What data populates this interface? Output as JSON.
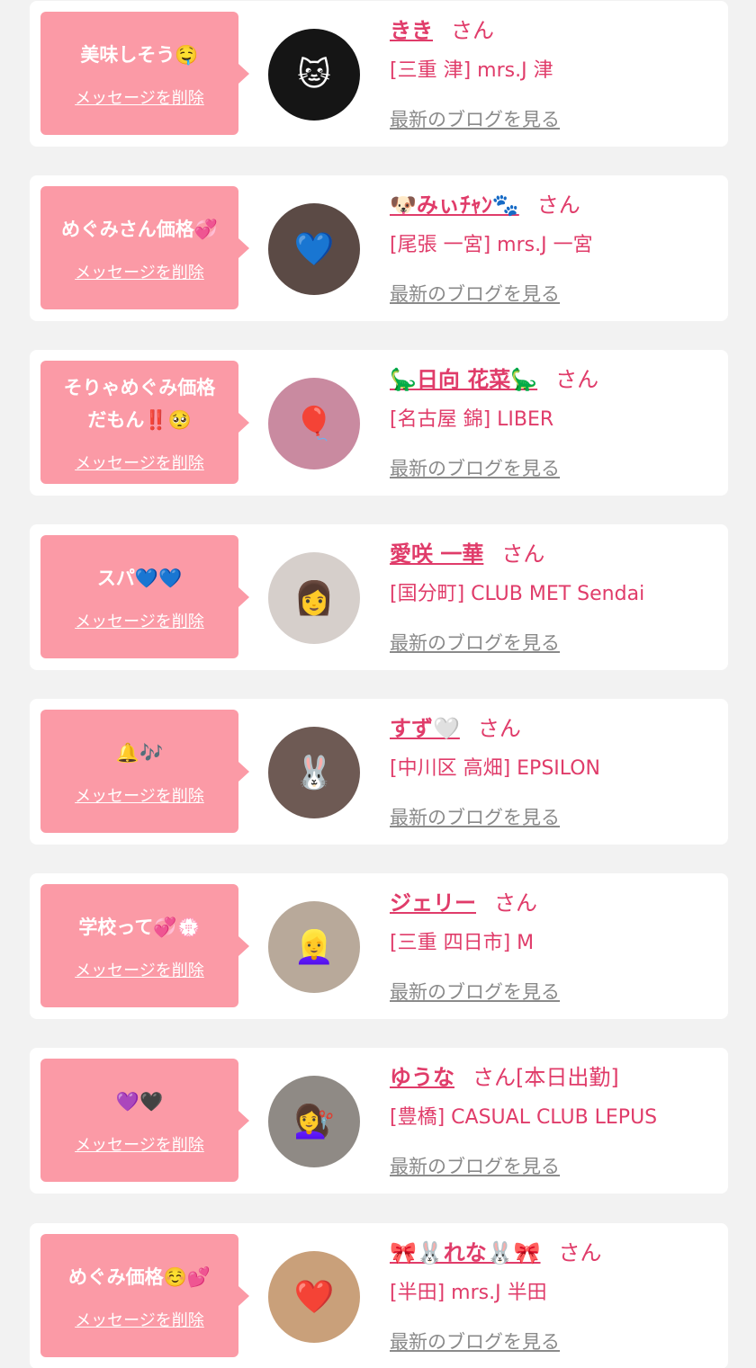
{
  "delete_label": "メッセージを削除",
  "blog_label": "最新のブログを見る",
  "honorific": "さん",
  "colors": {
    "bubble": "#fb9aa6",
    "accent": "#e03c6a",
    "muted": "#8a8a8a",
    "page_bg": "#f2f2f2"
  },
  "messages": [
    {
      "message": "美味しそう🤤",
      "name": "きき",
      "suffix": "さん",
      "shop": "[三重 津] mrs.J 津",
      "avatar_icon": "black-cat-avatar",
      "avatar_bg": "#151515",
      "avatar_glyph": "🐱"
    },
    {
      "message": "めぐみさん価格💞",
      "name": "🐶みぃﾁｬﾝ🐾",
      "suffix": "さん",
      "shop": "[尾張 一宮] mrs.J 一宮",
      "avatar_icon": "woman-heart-sticker-avatar",
      "avatar_bg": "#5b4a45",
      "avatar_glyph": "💙"
    },
    {
      "message": "そりゃめぐみ価格\nだもん‼️🥺",
      "name": "🦕日向 花菜🦕",
      "suffix": "さん",
      "shop": "[名古屋 錦] LIBER",
      "avatar_icon": "ball-pit-avatar",
      "avatar_bg": "#c98aa0",
      "avatar_glyph": "🎈"
    },
    {
      "message": "スパ💙💙",
      "name": "愛咲 一華",
      "suffix": "さん",
      "shop": "[国分町] CLUB MET Sendai",
      "avatar_icon": "woman-portrait-avatar",
      "avatar_bg": "#d6cfcb",
      "avatar_glyph": "👩"
    },
    {
      "message": "🔔🎶",
      "name": "すず🤍",
      "suffix": "さん",
      "shop": "[中川区 高畑] EPSILON",
      "avatar_icon": "bunny-ears-woman-avatar",
      "avatar_bg": "#6e5a54",
      "avatar_glyph": "🐰"
    },
    {
      "message": "学校って💞💮",
      "name": "ジェリー",
      "suffix": "さん",
      "shop": "[三重 四日市] M",
      "avatar_icon": "blonde-woman-avatar",
      "avatar_bg": "#b8a99a",
      "avatar_glyph": "👱‍♀️"
    },
    {
      "message": "💜🖤",
      "name": "ゆうな",
      "suffix": "さん[本日出勤]",
      "shop": "[豊橋] CASUAL CLUB LEPUS",
      "avatar_icon": "blonde-hair-back-avatar",
      "avatar_bg": "#8f8a85",
      "avatar_glyph": "💇‍♀️"
    },
    {
      "message": "めぐみ価格☺️💕",
      "name": "🎀🐰れな🐰🎀",
      "suffix": "さん",
      "shop": "[半田] mrs.J 半田",
      "avatar_icon": "red-heart-woman-avatar",
      "avatar_bg": "#c9a07a",
      "avatar_glyph": "❤️"
    }
  ]
}
